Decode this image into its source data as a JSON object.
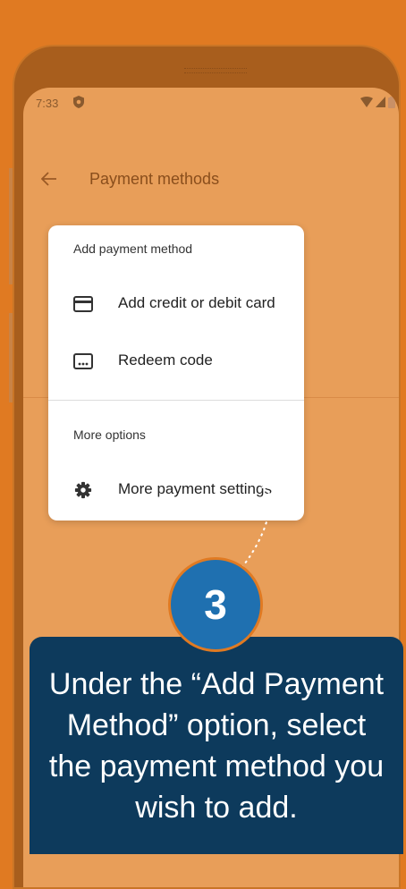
{
  "status_bar": {
    "time": "7:33"
  },
  "app_bar": {
    "title": "Payment methods"
  },
  "menu": {
    "header_add": "Add payment method",
    "items_add": [
      {
        "label": "Add credit or debit card",
        "icon": "credit-card-icon"
      },
      {
        "label": "Redeem code",
        "icon": "redeem-code-icon"
      }
    ],
    "header_more": "More options",
    "items_more": [
      {
        "label": "More payment settings",
        "icon": "gear-icon"
      }
    ]
  },
  "tutorial": {
    "step_number": "3",
    "instruction": "Under the “Add Payment Method” option, select the payment method you wish to add."
  },
  "colors": {
    "background": "#e07a22",
    "screen": "#e89e59",
    "badge": "#1f70b0",
    "callout": "#0d3a5c"
  }
}
